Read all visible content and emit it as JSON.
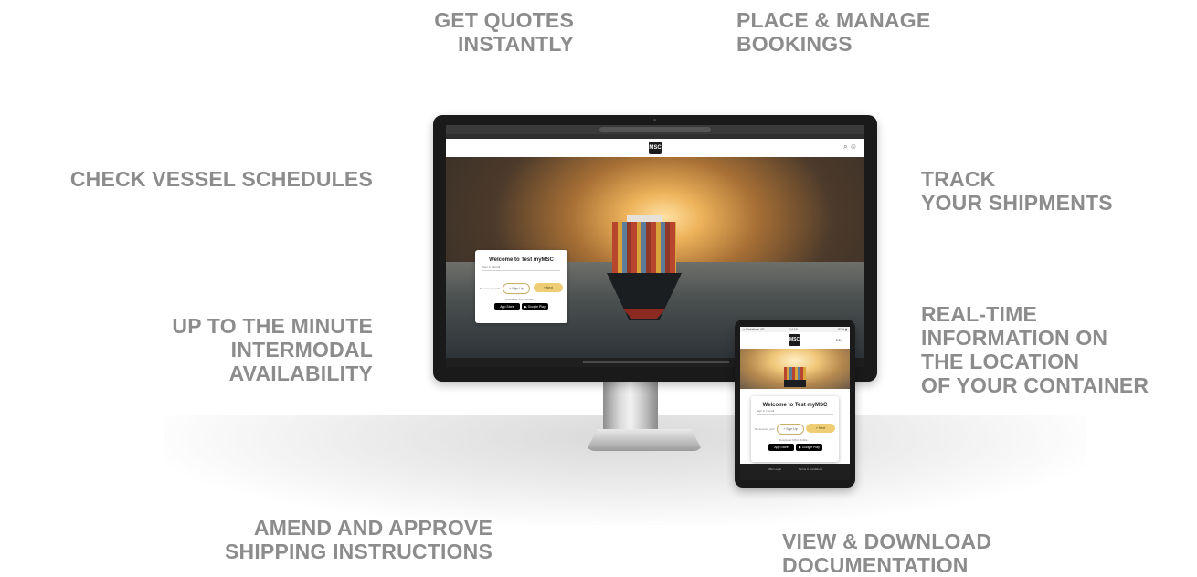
{
  "features": {
    "quotes": [
      "GET QUOTES",
      "INSTANTLY"
    ],
    "bookings": [
      "PLACE & MANAGE",
      "BOOKINGS"
    ],
    "schedules": [
      "CHECK VESSEL SCHEDULES"
    ],
    "track": [
      "TRACK",
      "YOUR SHIPMENTS"
    ],
    "intermodal": [
      "UP TO THE MINUTE",
      "INTERMODAL",
      "AVAILABILITY"
    ],
    "realtime": [
      "REAL-TIME",
      "INFORMATION ON",
      "THE LOCATION",
      "OF YOUR CONTAINER"
    ],
    "amend": [
      "AMEND AND APPROVE",
      "SHIPPING INSTRUCTIONS"
    ],
    "documentation": [
      "VIEW & DOWNLOAD",
      "DOCUMENTATION"
    ]
  },
  "desktop_site": {
    "logo": "MSC",
    "header_icons": "⌕  ☺",
    "login_card": {
      "title": "Welcome to Test myMSC",
      "subtitle": "Sign in / Email",
      "question": "No account yet?",
      "signup_label": "+ Sign Up",
      "next_label": "» Next",
      "download_label": "Download MSC Mobile",
      "app_store": " App Store",
      "google_play": "▶ Google Play"
    }
  },
  "tablet_site": {
    "status_left": "● Vodafone 4G",
    "status_time": "14:19",
    "status_right": "81% ▮",
    "logo": "MSC",
    "language": "EN ⌄",
    "login_card": {
      "title": "Welcome to Test myMSC",
      "subtitle": "Sign in / Email",
      "question": "No account yet?",
      "signup_label": "+ Sign Up",
      "next_label": "» Next",
      "download_label": "Download MSC Mobile",
      "app_store": " App Store",
      "google_play": "▶ Google Play"
    },
    "footer_left": "MSC Legal",
    "footer_right": "Terms & Conditions"
  },
  "colors": {
    "feature_text": "#8c8c8c",
    "accent_button": "#efcd74",
    "device_frame": "#1a1a1a"
  }
}
